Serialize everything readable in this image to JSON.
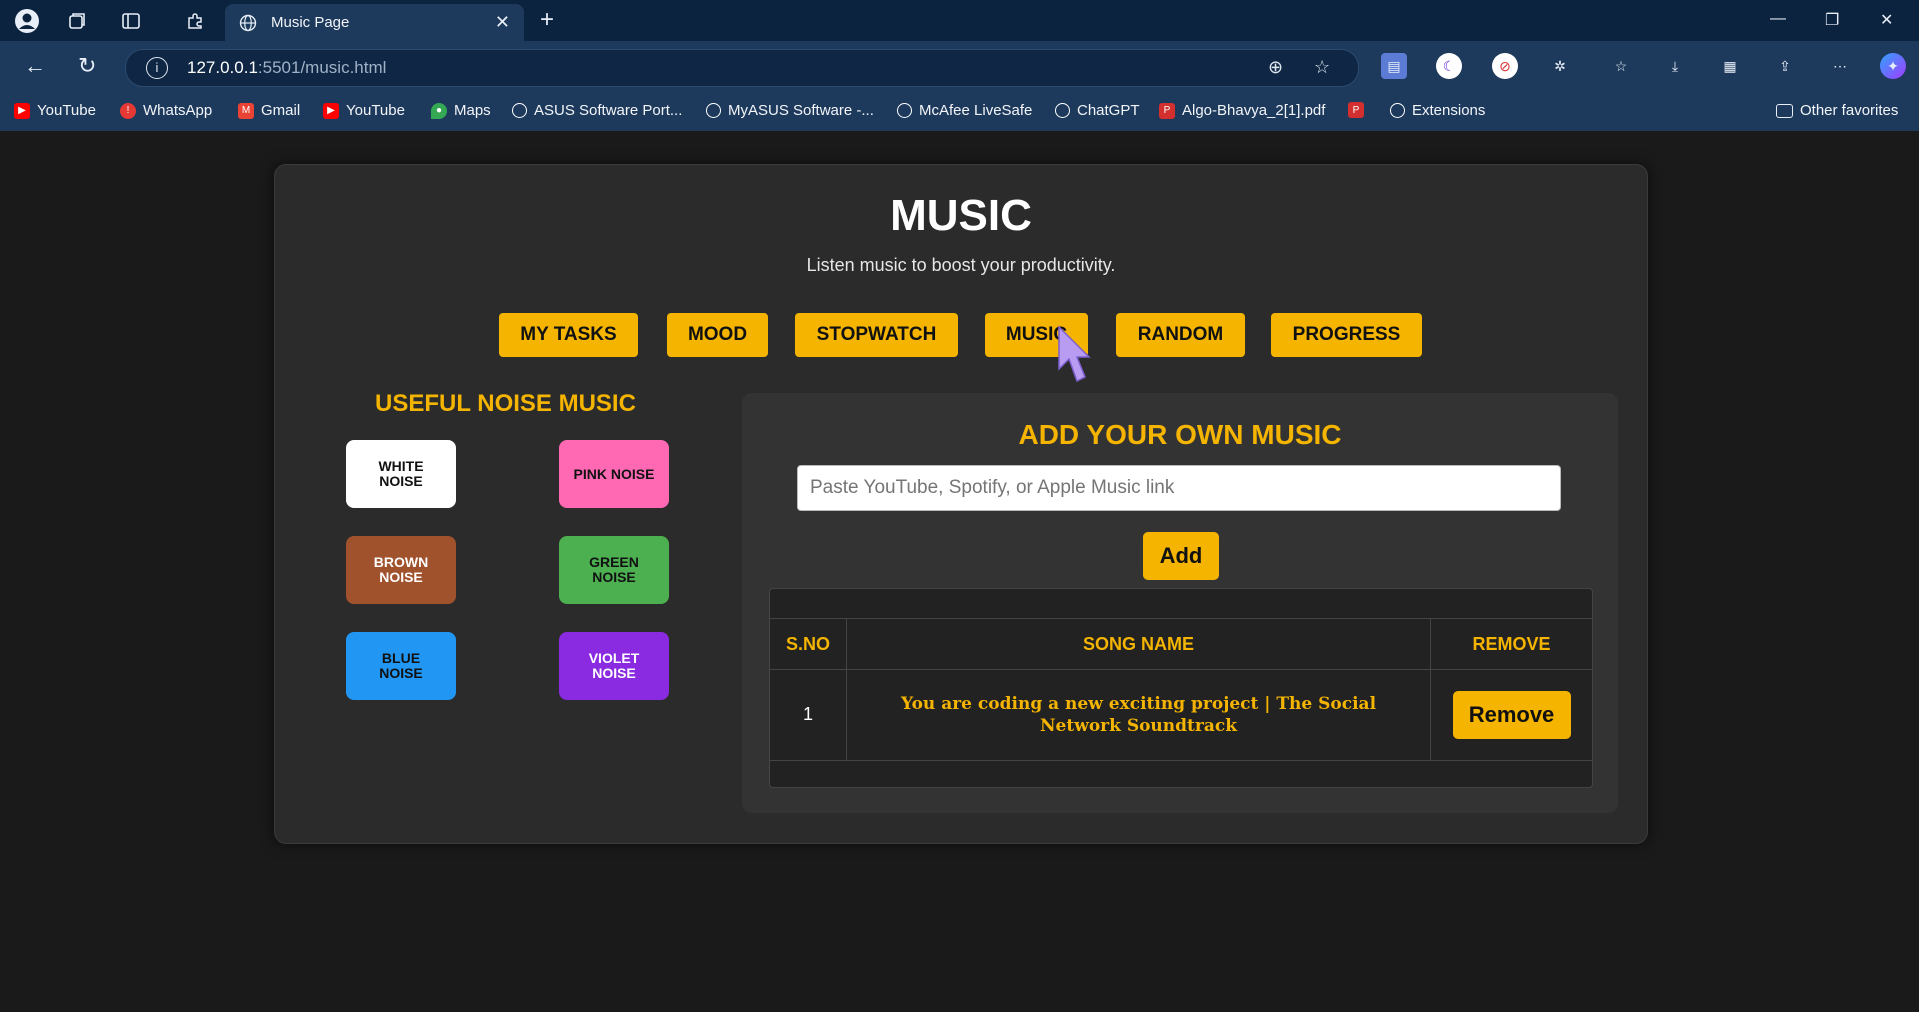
{
  "browser": {
    "tab_title": "Music Page",
    "url_host": "127.0.0.1",
    "url_rest": ":5501/music.html",
    "bookmarks": [
      {
        "label": "YouTube",
        "icon": "youtube-icon",
        "color": "#ff0000"
      },
      {
        "label": "WhatsApp",
        "icon": "whatsapp-icon",
        "color": "#e53935"
      },
      {
        "label": "Gmail",
        "icon": "gmail-icon",
        "color": "#ea4335"
      },
      {
        "label": "YouTube",
        "icon": "youtube-icon",
        "color": "#ff0000"
      },
      {
        "label": "Maps",
        "icon": "maps-icon",
        "color": "#34a853"
      },
      {
        "label": "ASUS Software Port...",
        "icon": "globe-icon",
        "color": "#ffffff"
      },
      {
        "label": "MyASUS Software -...",
        "icon": "globe-icon",
        "color": "#ffffff"
      },
      {
        "label": "McAfee LiveSafe",
        "icon": "globe-icon",
        "color": "#ffffff"
      },
      {
        "label": "ChatGPT",
        "icon": "chatgpt-icon",
        "color": "#ffffff"
      },
      {
        "label": "Algo-Bhavya_2[1].pdf",
        "icon": "pdf-icon",
        "color": "#d32f2f"
      },
      {
        "label": "",
        "icon": "pdf-icon",
        "color": "#d32f2f"
      },
      {
        "label": "Extensions",
        "icon": "extensions-icon",
        "color": "#ffffff"
      }
    ],
    "other_favorites": "Other favorites"
  },
  "page": {
    "title": "MUSIC",
    "subtitle": "Listen music to boost your productivity.",
    "nav": [
      "MY TASKS",
      "MOOD",
      "STOPWATCH",
      "MUSIC",
      "RANDOM",
      "PROGRESS"
    ],
    "noise_section_title": "USEFUL NOISE MUSIC",
    "noises": [
      {
        "line1": "WHITE",
        "line2": "NOISE",
        "bg": "#ffffff",
        "fg": "#111111"
      },
      {
        "line1": "PINK NOISE",
        "line2": "",
        "bg": "#ff69b4",
        "fg": "#111111"
      },
      {
        "line1": "BROWN",
        "line2": "NOISE",
        "bg": "#a0522d",
        "fg": "#ffffff"
      },
      {
        "line1": "GREEN",
        "line2": "NOISE",
        "bg": "#4caf50",
        "fg": "#111111"
      },
      {
        "line1": "BLUE",
        "line2": "NOISE",
        "bg": "#2196f3",
        "fg": "#111111"
      },
      {
        "line1": "VIOLET",
        "line2": "NOISE",
        "bg": "#8a2be2",
        "fg": "#ffffff"
      }
    ],
    "add_music": {
      "title": "ADD YOUR OWN MUSIC",
      "placeholder": "Paste YouTube, Spotify, or Apple Music link",
      "add_label": "Add",
      "headers": [
        "S.NO",
        "SONG NAME",
        "REMOVE"
      ],
      "rows": [
        {
          "sno": "1",
          "song": "You are coding a new exciting project | The Social Network Soundtrack",
          "remove": "Remove"
        }
      ]
    },
    "accent_color": "#f4b400"
  }
}
